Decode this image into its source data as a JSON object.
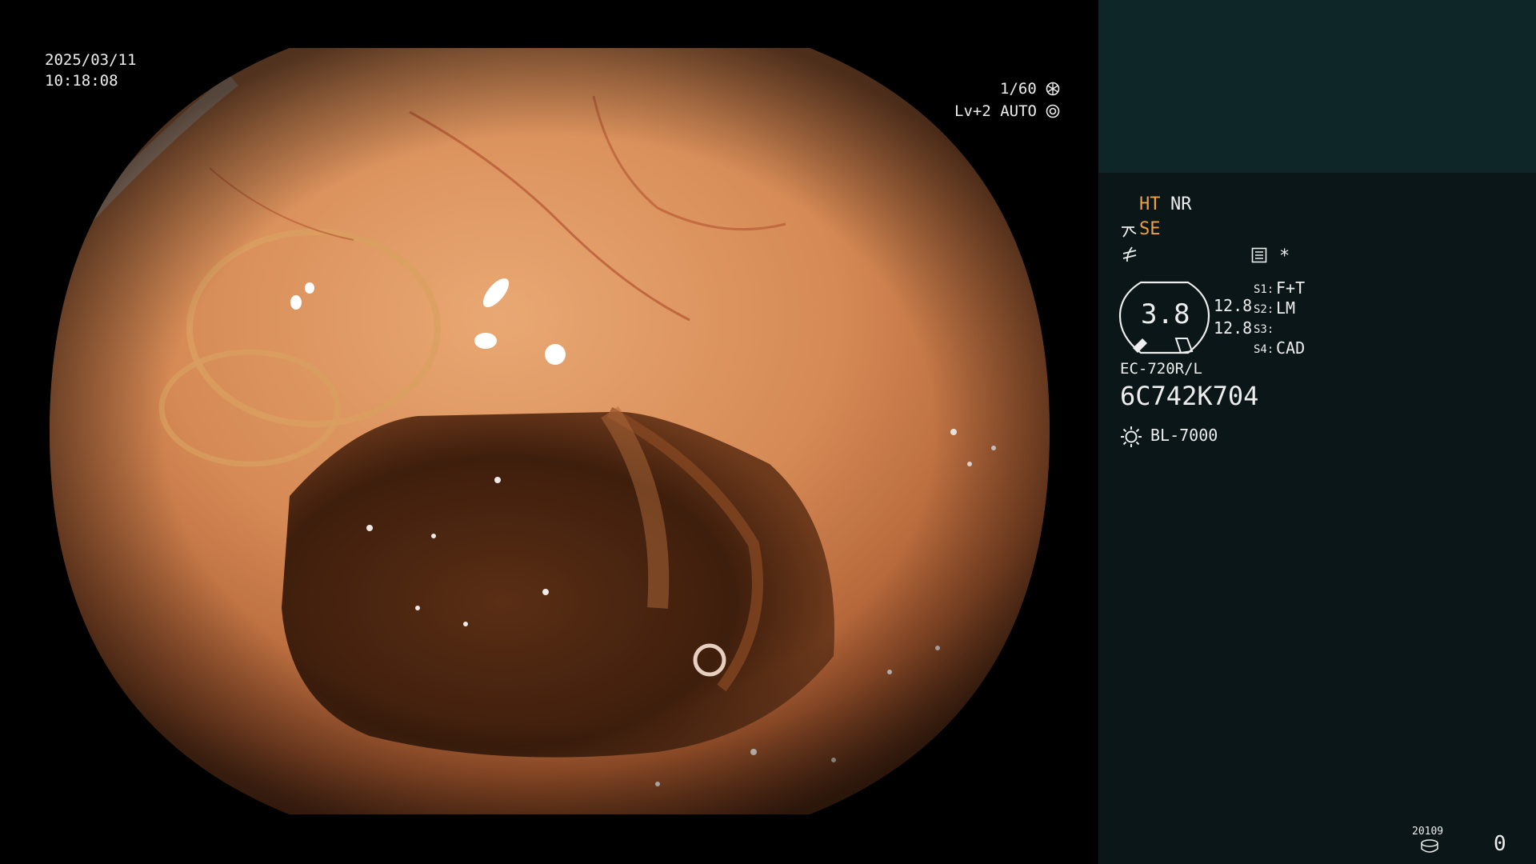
{
  "overlay": {
    "date": "2025/03/11",
    "time": "10:18:08",
    "shutter": "1/60",
    "shutter_icon": "aperture-icon",
    "level": "Lv+2",
    "exposure": "AUTO",
    "exposure_icon": "iris-icon"
  },
  "panel": {
    "ht": "HT",
    "nr": "NR",
    "se": "SE",
    "zoom_value": "3.8",
    "val_top": "12.8",
    "val_bottom": "12.8",
    "star": "*",
    "s1_key": "S1:",
    "s1_val": "F+T",
    "s2_key": "S2:",
    "s2_val": "LM",
    "s3_key": "S3:",
    "s3_val": "",
    "s4_key": "S4:",
    "s4_val": "CAD",
    "scope_model": "EC-720R/L",
    "serial": "6C742K704",
    "light_source": "BL-7000",
    "storage_code": "20109",
    "count": "0"
  },
  "colors": {
    "panel_bg": "#0a1617",
    "panel_top_bg": "#0f2628",
    "accent_orange": "#f0a040",
    "text": "#eeeeee"
  },
  "icons": [
    "aperture-icon",
    "iris-icon",
    "scissors-icon",
    "wave-icon",
    "menu-icon",
    "lamp-icon",
    "disk-icon"
  ]
}
